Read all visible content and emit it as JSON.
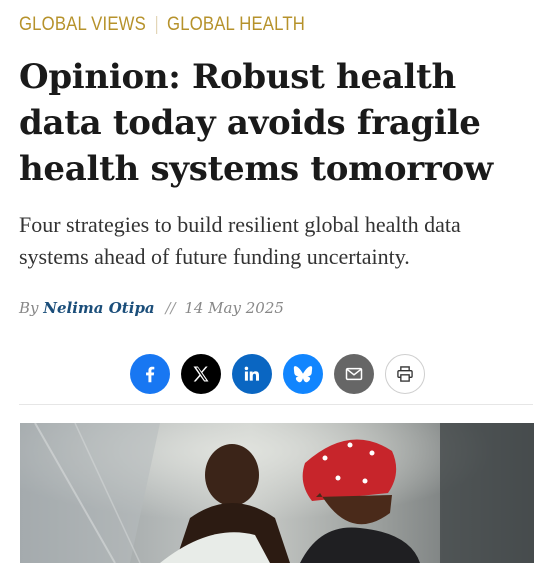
{
  "topics": [
    {
      "label": "Global Views"
    },
    {
      "label": "Global Health"
    }
  ],
  "article": {
    "headline": "Opinion: Robust health data today avoids fragile health systems tomorrow",
    "subhead": "Four strategies to build resilient global health data systems ahead of future funding uncertainty.",
    "byline_prefix": "By",
    "author": "Nelima Otipa",
    "date_separator": "//",
    "date": "14 May 2025"
  },
  "share": {
    "buttons": [
      {
        "icon": "facebook-icon",
        "color": "#1877f2"
      },
      {
        "icon": "x-icon",
        "color": "#000000"
      },
      {
        "icon": "linkedin-icon",
        "color": "#0a66c2"
      },
      {
        "icon": "bluesky-icon",
        "color": "#1185fe"
      },
      {
        "icon": "email-icon",
        "color": "#666666"
      },
      {
        "icon": "print-icon",
        "color": "#ffffff"
      }
    ]
  },
  "colors": {
    "topic_gold": "#b6922b",
    "author_blue": "#1b4e7a",
    "headline": "#1a1a1a"
  }
}
